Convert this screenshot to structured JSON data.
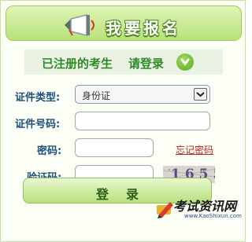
{
  "header": {
    "title": "我要报名"
  },
  "subheader": {
    "text": "已注册的考生",
    "action": "请登录"
  },
  "form": {
    "id_type_label": "证件类型:",
    "id_type_value": "身份证",
    "id_number_label": "证件号码:",
    "id_number_value": "",
    "password_label": "密码:",
    "password_value": "",
    "forgot_password": "忘记密码",
    "captcha_label": "验证码:",
    "captcha_value": "",
    "captcha_image_text": "1655"
  },
  "login_button": {
    "label": "登录"
  },
  "watermark": {
    "title": "考试资讯网",
    "url": "www.KaoShixun.com"
  },
  "colors": {
    "accent_green": "#2f8b2a",
    "label_blue": "#204f7c",
    "link_red": "#b3261e"
  },
  "icons": {
    "banner": "megaphone-icon",
    "subheader": "arrow-down-circle-icon",
    "select": "chevron-down-icon"
  }
}
